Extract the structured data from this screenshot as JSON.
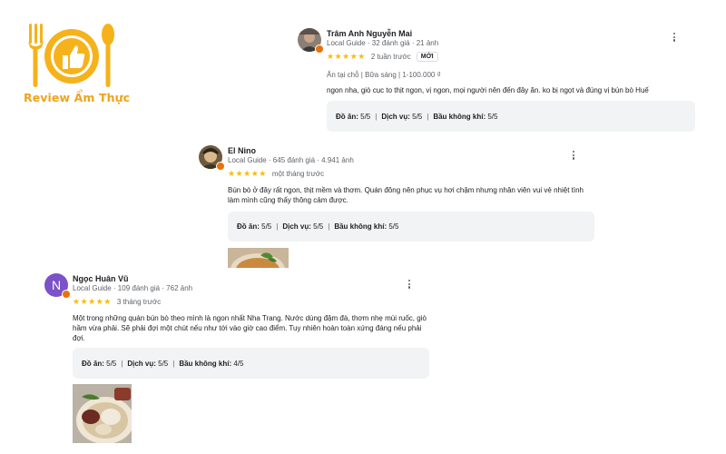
{
  "brand": {
    "name": "Review Ẩm Thực",
    "color": "#f0a31a"
  },
  "reviews": [
    {
      "author": "Trâm Anh Nguyễn Mai",
      "meta": "Local Guide · 32 đánh giá · 21 ảnh",
      "stars": "★★★★★",
      "time": "2 tuần trước",
      "badge": "MỚI",
      "tags": "Ăn tại chỗ  |  Bữa sáng  |  1-100.000 ₫",
      "text": "ngon nha, giò cục to thịt ngon, vị ngon, mọi người nên đến đây ăn. ko bị ngọt và đúng vị bún bò Huế",
      "scores": {
        "food_label": "Đồ ăn:",
        "food": "5/5",
        "service_label": "Dịch vụ:",
        "service": "5/5",
        "atmosphere_label": "Bầu không khí:",
        "atmosphere": "5/5"
      }
    },
    {
      "author": "El Nino",
      "meta": "Local Guide · 645 đánh giá · 4.941 ảnh",
      "stars": "★★★★★",
      "time": "một tháng trước",
      "text": "Bún bò ở đây rất ngon, thịt mềm và thơm. Quán đông nên phục vụ hơi chậm nhưng nhân viên vui vẻ nhiệt tình làm mình cũng thấy thông cảm được.",
      "scores": {
        "food_label": "Đồ ăn:",
        "food": "5/5",
        "service_label": "Dịch vụ:",
        "service": "5/5",
        "atmosphere_label": "Bầu không khí:",
        "atmosphere": "5/5"
      }
    },
    {
      "author": "Ngọc Huân Vũ",
      "avatar_letter": "N",
      "meta": "Local Guide · 109 đánh giá · 762 ảnh",
      "stars": "★★★★★",
      "time": "3 tháng trước",
      "text": "Một trong những quán bún bò theo mình là ngon nhất Nha Trang. Nước dùng đậm đà, thơm nhẹ mùi ruốc, giò hầm vừa phải. Sẽ phải đợi một chút nếu như tới vào giờ cao điểm. Tuy nhiên hoàn toàn xứng đáng nếu phải đợi.",
      "scores": {
        "food_label": "Đồ ăn:",
        "food": "5/5",
        "service_label": "Dịch vụ:",
        "service": "5/5",
        "atmosphere_label": "Bầu không khí:",
        "atmosphere": "4/5"
      }
    }
  ]
}
